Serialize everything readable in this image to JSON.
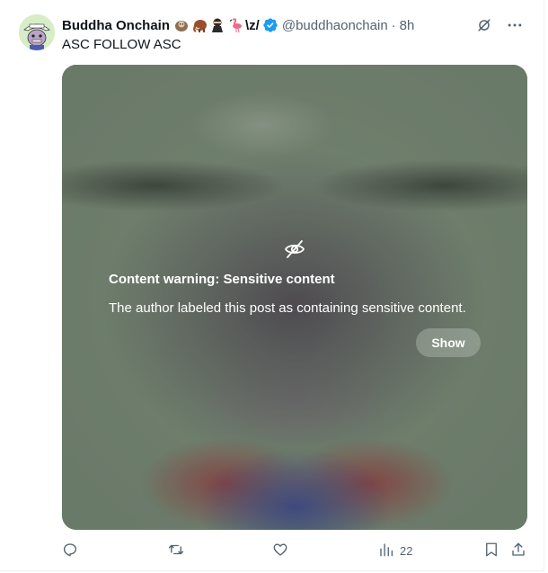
{
  "author": {
    "display_name": "Buddha Onchain",
    "name_suffix": "\\z/",
    "emojis": [
      "sloth",
      "mammoth",
      "ninja",
      "flamingo"
    ],
    "handle": "@buddhaonchain",
    "separator": "·",
    "time": "8h",
    "verified": true
  },
  "post": {
    "text": "ASC FOLLOW ASC"
  },
  "media": {
    "warning_icon": "eye-off-icon",
    "warning_title": "Content warning: Sensitive content",
    "warning_body": "The author labeled this post as containing sensitive content.",
    "show_label": "Show"
  },
  "top_icons": [
    "grok-icon",
    "more-icon"
  ],
  "actions": {
    "reply": {
      "icon": "reply-icon",
      "count": ""
    },
    "repost": {
      "icon": "repost-icon",
      "count": ""
    },
    "like": {
      "icon": "like-icon",
      "count": ""
    },
    "views": {
      "icon": "views-icon",
      "count": "22"
    },
    "bookmark": {
      "icon": "bookmark-icon"
    },
    "share": {
      "icon": "share-icon"
    }
  },
  "colors": {
    "accent": "#1d9bf0",
    "text": "#0f1419",
    "muted": "#536471"
  }
}
